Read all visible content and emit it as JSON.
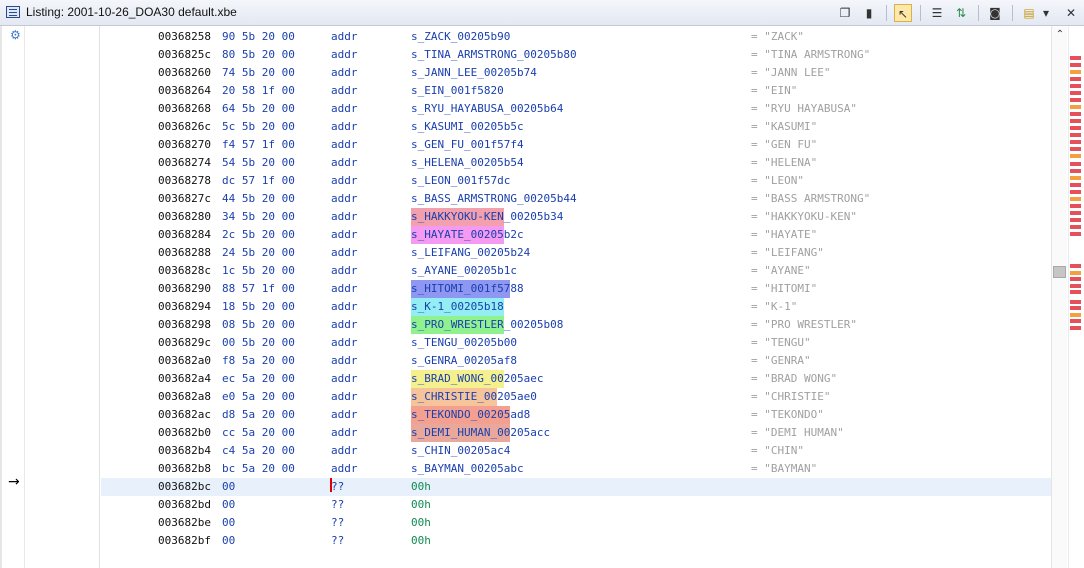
{
  "window": {
    "title": "Listing:  2001-10-26_DOA30 default.xbe",
    "icon": "listing-window-icon"
  },
  "toolbar": {
    "buttons": [
      {
        "name": "copy-icon",
        "glyph": "❐"
      },
      {
        "name": "paste-icon",
        "glyph": "▮"
      },
      {
        "name": "cursor-select-icon",
        "glyph": "↖"
      },
      {
        "name": "field-layout-icon",
        "glyph": "☰"
      },
      {
        "name": "diff-view-icon",
        "glyph": "⇅"
      },
      {
        "name": "snapshot-camera-icon",
        "glyph": "◙"
      },
      {
        "name": "memory-map-icon",
        "glyph": "▤"
      },
      {
        "name": "dropdown-arrow-icon",
        "glyph": "▾"
      },
      {
        "name": "close-icon",
        "glyph": "✕"
      }
    ]
  },
  "listing": {
    "rows": [
      {
        "address": "00368258",
        "bytes": "90 5b 20 00",
        "mnemonic": "addr",
        "operand": "s_ZACK_00205b90",
        "comment": "= \"ZACK\""
      },
      {
        "address": "0036825c",
        "bytes": "80 5b 20 00",
        "mnemonic": "addr",
        "operand": "s_TINA_ARMSTRONG_00205b80",
        "comment": "= \"TINA ARMSTRONG\""
      },
      {
        "address": "00368260",
        "bytes": "74 5b 20 00",
        "mnemonic": "addr",
        "operand": "s_JANN_LEE_00205b74",
        "comment": "= \"JANN LEE\""
      },
      {
        "address": "00368264",
        "bytes": "20 58 1f 00",
        "mnemonic": "addr",
        "operand": "s_EIN_001f5820",
        "comment": "= \"EIN\""
      },
      {
        "address": "00368268",
        "bytes": "64 5b 20 00",
        "mnemonic": "addr",
        "operand": "s_RYU_HAYABUSA_00205b64",
        "comment": "= \"RYU HAYABUSA\""
      },
      {
        "address": "0036826c",
        "bytes": "5c 5b 20 00",
        "mnemonic": "addr",
        "operand": "s_KASUMI_00205b5c",
        "comment": "= \"KASUMI\""
      },
      {
        "address": "00368270",
        "bytes": "f4 57 1f 00",
        "mnemonic": "addr",
        "operand": "s_GEN_FU_001f57f4",
        "comment": "= \"GEN FU\""
      },
      {
        "address": "00368274",
        "bytes": "54 5b 20 00",
        "mnemonic": "addr",
        "operand": "s_HELENA_00205b54",
        "comment": "= \"HELENA\""
      },
      {
        "address": "00368278",
        "bytes": "dc 57 1f 00",
        "mnemonic": "addr",
        "operand": "s_LEON_001f57dc",
        "comment": "= \"LEON\""
      },
      {
        "address": "0036827c",
        "bytes": "44 5b 20 00",
        "mnemonic": "addr",
        "operand": "s_BASS_ARMSTRONG_00205b44",
        "comment": "= \"BASS ARMSTRONG\""
      },
      {
        "address": "00368280",
        "bytes": "34 5b 20 00",
        "mnemonic": "addr",
        "operand": "s_HAKKYOKU-KEN_00205b34",
        "comment": "= \"HAKKYOKU-KEN\"",
        "hl_text": "s_HAKKYOKU-KEN",
        "hl_rest": "_00205b34",
        "hl_color": "#f3a0ae"
      },
      {
        "address": "00368284",
        "bytes": "2c 5b 20 00",
        "mnemonic": "addr",
        "operand": "s_HAYATE_00205b2c",
        "comment": "= \"HAYATE\"",
        "hl_text": "s_HAYATE_00205",
        "hl_rest": "b2c",
        "hl_color": "#f49af0"
      },
      {
        "address": "00368288",
        "bytes": "24 5b 20 00",
        "mnemonic": "addr",
        "operand": "s_LEIFANG_00205b24",
        "comment": "= \"LEIFANG\""
      },
      {
        "address": "0036828c",
        "bytes": "1c 5b 20 00",
        "mnemonic": "addr",
        "operand": "s_AYANE_00205b1c",
        "comment": "= \"AYANE\""
      },
      {
        "address": "00368290",
        "bytes": "88 57 1f 00",
        "mnemonic": "addr",
        "operand": "s_HITOMI_001f5788",
        "comment": "= \"HITOMI\"",
        "hl_text": "s_HITOMI_001f57",
        "hl_rest": "88",
        "hl_color": "#8e97f2"
      },
      {
        "address": "00368294",
        "bytes": "18 5b 20 00",
        "mnemonic": "addr",
        "operand": "s_K-1_00205b18",
        "comment": "= \"K-1\"",
        "hl_text": "s_K-1_00205b18",
        "hl_rest": "",
        "hl_color": "#93eef4"
      },
      {
        "address": "00368298",
        "bytes": "08 5b 20 00",
        "mnemonic": "addr",
        "operand": "s_PRO_WRESTLER_00205b08",
        "comment": "= \"PRO WRESTLER\"",
        "hl_text": "s_PRO_WRESTLER",
        "hl_rest": "_00205b08",
        "hl_color": "#8ff28f"
      },
      {
        "address": "0036829c",
        "bytes": "00 5b 20 00",
        "mnemonic": "addr",
        "operand": "s_TENGU_00205b00",
        "comment": "= \"TENGU\""
      },
      {
        "address": "003682a0",
        "bytes": "f8 5a 20 00",
        "mnemonic": "addr",
        "operand": "s_GENRA_00205af8",
        "comment": "= \"GENRA\""
      },
      {
        "address": "003682a4",
        "bytes": "ec 5a 20 00",
        "mnemonic": "addr",
        "operand": "s_BRAD_WONG_00205aec",
        "comment": "= \"BRAD WONG\"",
        "hl_text": "s_BRAD_WONG_00",
        "hl_rest": "205aec",
        "hl_color": "#f4f08e"
      },
      {
        "address": "003682a8",
        "bytes": "e0 5a 20 00",
        "mnemonic": "addr",
        "operand": "s_CHRISTIE_00205ae0",
        "comment": "= \"CHRISTIE\"",
        "hl_text": "s_CHRISTIE_00",
        "hl_rest": "205ae0",
        "hl_color": "#f6c49a"
      },
      {
        "address": "003682ac",
        "bytes": "d8 5a 20 00",
        "mnemonic": "addr",
        "operand": "s_TEKONDO_00205ad8",
        "comment": "= \"TEKONDO\"",
        "hl_text": "s_TEKONDO_00205",
        "hl_rest": "ad8",
        "hl_color": "#f4a090"
      },
      {
        "address": "003682b0",
        "bytes": "cc 5a 20 00",
        "mnemonic": "addr",
        "operand": "s_DEMI_HUMAN_00205acc",
        "comment": "= \"DEMI HUMAN\"",
        "hl_text": "s_DEMI_HUMAN_00",
        "hl_rest": "205acc",
        "hl_color": "#e8a89c"
      },
      {
        "address": "003682b4",
        "bytes": "c4 5a 20 00",
        "mnemonic": "addr",
        "operand": "s_CHIN_00205ac4",
        "comment": "= \"CHIN\""
      },
      {
        "address": "003682b8",
        "bytes": "bc 5a 20 00",
        "mnemonic": "addr",
        "operand": "s_BAYMAN_00205abc",
        "comment": "= \"BAYMAN\""
      },
      {
        "address": "003682bc",
        "bytes": "00",
        "mnemonic": "??",
        "operand": "00h",
        "comment": "",
        "selected": true,
        "hex": true
      },
      {
        "address": "003682bd",
        "bytes": "00",
        "mnemonic": "??",
        "operand": "00h",
        "comment": "",
        "hex": true
      },
      {
        "address": "003682be",
        "bytes": "00",
        "mnemonic": "??",
        "operand": "00h",
        "comment": "",
        "hex": true
      },
      {
        "address": "003682bf",
        "bytes": "00",
        "mnemonic": "??",
        "operand": "00h",
        "comment": "",
        "hex": true
      }
    ]
  },
  "margin": {
    "gear_icon": "gear-icon",
    "cursor_marker": "→"
  },
  "scrollbar": {
    "up_glyph": "⌃"
  },
  "overview_bar": {
    "marks_color": "#e6505a",
    "marks": [
      {
        "at": 0.055,
        "color": "#e6505a"
      },
      {
        "at": 0.068,
        "color": "#e6505a"
      },
      {
        "at": 0.081,
        "color": "#f2a040"
      },
      {
        "at": 0.094,
        "color": "#e6505a"
      },
      {
        "at": 0.107,
        "color": "#e6505a"
      },
      {
        "at": 0.12,
        "color": "#e6505a"
      },
      {
        "at": 0.133,
        "color": "#e6505a"
      },
      {
        "at": 0.146,
        "color": "#f2a040"
      },
      {
        "at": 0.159,
        "color": "#e6505a"
      },
      {
        "at": 0.172,
        "color": "#e6505a"
      },
      {
        "at": 0.185,
        "color": "#e6505a"
      },
      {
        "at": 0.198,
        "color": "#e6505a"
      },
      {
        "at": 0.211,
        "color": "#e6505a"
      },
      {
        "at": 0.224,
        "color": "#e6505a"
      },
      {
        "at": 0.237,
        "color": "#f2a040"
      },
      {
        "at": 0.25,
        "color": "#e6505a"
      },
      {
        "at": 0.263,
        "color": "#e6505a"
      },
      {
        "at": 0.276,
        "color": "#f2a040"
      },
      {
        "at": 0.289,
        "color": "#e6505a"
      },
      {
        "at": 0.302,
        "color": "#e6505a"
      },
      {
        "at": 0.315,
        "color": "#f2a040"
      },
      {
        "at": 0.328,
        "color": "#e6505a"
      },
      {
        "at": 0.341,
        "color": "#e6505a"
      },
      {
        "at": 0.354,
        "color": "#e6505a"
      },
      {
        "at": 0.367,
        "color": "#e6505a"
      },
      {
        "at": 0.38,
        "color": "#e6505a"
      },
      {
        "at": 0.44,
        "color": "#e6505a"
      },
      {
        "at": 0.452,
        "color": "#f2a040"
      },
      {
        "at": 0.464,
        "color": "#e6505a"
      },
      {
        "at": 0.476,
        "color": "#e6505a"
      },
      {
        "at": 0.488,
        "color": "#e6505a"
      },
      {
        "at": 0.505,
        "color": "#e6505a"
      },
      {
        "at": 0.517,
        "color": "#e6505a"
      },
      {
        "at": 0.529,
        "color": "#f2a040"
      },
      {
        "at": 0.541,
        "color": "#e6505a"
      },
      {
        "at": 0.553,
        "color": "#e6505a"
      }
    ]
  }
}
